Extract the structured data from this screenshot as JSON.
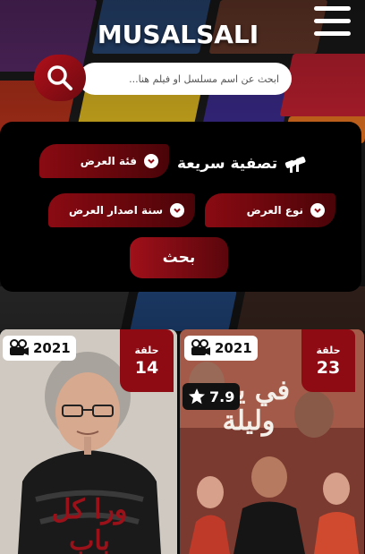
{
  "header": {
    "logo_text": "MUSALSALI",
    "menu_icon": "hamburger-menu-icon"
  },
  "search": {
    "placeholder": "ابحث عن اسم مسلسل او فيلم هنا...",
    "icon": "search-icon",
    "accent": "#a50f18"
  },
  "filter": {
    "title": "تصفية سريعة",
    "title_icon": "binoculars-icon",
    "category_label": "فئة العرض",
    "type_label": "نوع العرض",
    "year_label": "سنة اصدار العرض",
    "submit_label": "بحث"
  },
  "cards": [
    {
      "episode_label": "حلقة",
      "episode_number": "14",
      "year": "2021",
      "title_art": "ورا كل باب"
    },
    {
      "episode_label": "حلقة",
      "episode_number": "23",
      "year": "2021",
      "rating": "7.9",
      "title_art": "في يوم وليلة"
    }
  ],
  "colors": {
    "brand_red": "#8e0b14",
    "panel_bg": "#000000"
  }
}
